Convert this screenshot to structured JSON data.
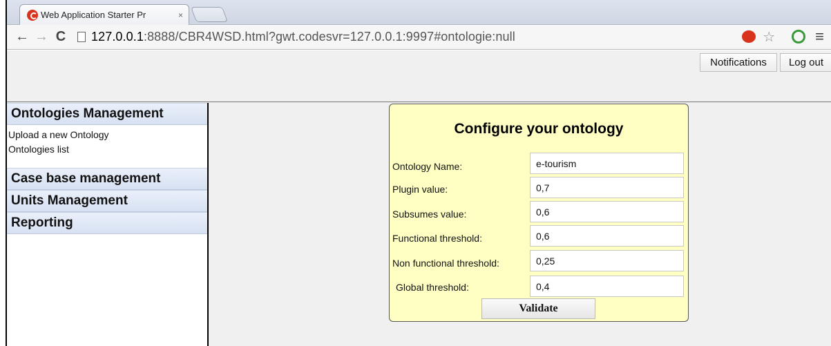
{
  "browser": {
    "tab_title": "Web Application Starter Pr",
    "tab_close": "×",
    "url_host": "127.0.0.1",
    "url_rest": ":8888/CBR4WSD.html?gwt.codesvr=127.0.0.1:9997#ontologie:null",
    "icons": {
      "back": "←",
      "forward": "→",
      "reload": "C",
      "star": "☆",
      "menu": "≡"
    }
  },
  "header": {
    "notifications_label": "Notifications",
    "logout_label": "Log out"
  },
  "sidebar": {
    "sections": [
      {
        "label": "Ontologies Management",
        "links": [
          "Upload a new Ontology",
          "Ontologies list"
        ]
      },
      {
        "label": "Case base management"
      },
      {
        "label": "Units Management"
      },
      {
        "label": "Reporting"
      }
    ]
  },
  "form": {
    "title": "Configure your ontology",
    "fields": [
      {
        "label": "Ontology Name:",
        "value": "e-tourism"
      },
      {
        "label": "Plugin value:",
        "value": "0,7"
      },
      {
        "label": "Subsumes value:",
        "value": "0,6"
      },
      {
        "label": "Functional threshold:",
        "value": "0,6"
      },
      {
        "label": "Non functional threshold:",
        "value": "0,25"
      },
      {
        "label": "Global  threshold:",
        "value": "0,4"
      }
    ],
    "validate_label": "Validate"
  },
  "colors": {
    "panel_bg": "#ffffc4",
    "stack_header": "#dbe4f4",
    "page_bg": "#f0f0f0"
  }
}
